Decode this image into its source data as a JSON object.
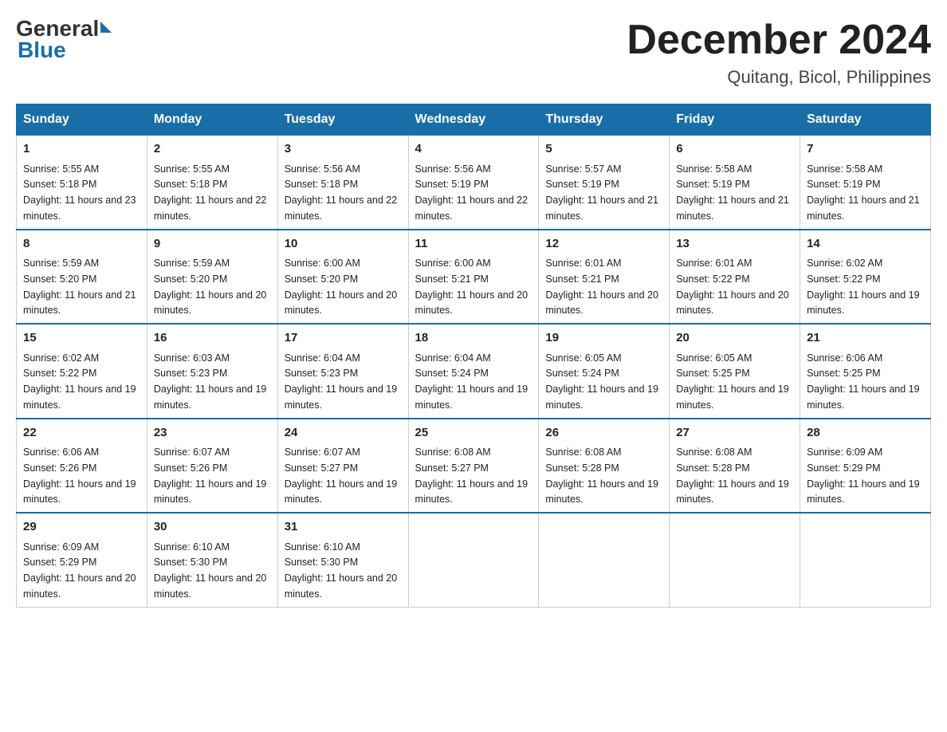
{
  "logo": {
    "general": "General",
    "blue": "Blue"
  },
  "header": {
    "month_year": "December 2024",
    "location": "Quitang, Bicol, Philippines"
  },
  "weekdays": [
    "Sunday",
    "Monday",
    "Tuesday",
    "Wednesday",
    "Thursday",
    "Friday",
    "Saturday"
  ],
  "weeks": [
    [
      {
        "day": "1",
        "sunrise": "5:55 AM",
        "sunset": "5:18 PM",
        "daylight": "11 hours and 23 minutes."
      },
      {
        "day": "2",
        "sunrise": "5:55 AM",
        "sunset": "5:18 PM",
        "daylight": "11 hours and 22 minutes."
      },
      {
        "day": "3",
        "sunrise": "5:56 AM",
        "sunset": "5:18 PM",
        "daylight": "11 hours and 22 minutes."
      },
      {
        "day": "4",
        "sunrise": "5:56 AM",
        "sunset": "5:19 PM",
        "daylight": "11 hours and 22 minutes."
      },
      {
        "day": "5",
        "sunrise": "5:57 AM",
        "sunset": "5:19 PM",
        "daylight": "11 hours and 21 minutes."
      },
      {
        "day": "6",
        "sunrise": "5:58 AM",
        "sunset": "5:19 PM",
        "daylight": "11 hours and 21 minutes."
      },
      {
        "day": "7",
        "sunrise": "5:58 AM",
        "sunset": "5:19 PM",
        "daylight": "11 hours and 21 minutes."
      }
    ],
    [
      {
        "day": "8",
        "sunrise": "5:59 AM",
        "sunset": "5:20 PM",
        "daylight": "11 hours and 21 minutes."
      },
      {
        "day": "9",
        "sunrise": "5:59 AM",
        "sunset": "5:20 PM",
        "daylight": "11 hours and 20 minutes."
      },
      {
        "day": "10",
        "sunrise": "6:00 AM",
        "sunset": "5:20 PM",
        "daylight": "11 hours and 20 minutes."
      },
      {
        "day": "11",
        "sunrise": "6:00 AM",
        "sunset": "5:21 PM",
        "daylight": "11 hours and 20 minutes."
      },
      {
        "day": "12",
        "sunrise": "6:01 AM",
        "sunset": "5:21 PM",
        "daylight": "11 hours and 20 minutes."
      },
      {
        "day": "13",
        "sunrise": "6:01 AM",
        "sunset": "5:22 PM",
        "daylight": "11 hours and 20 minutes."
      },
      {
        "day": "14",
        "sunrise": "6:02 AM",
        "sunset": "5:22 PM",
        "daylight": "11 hours and 19 minutes."
      }
    ],
    [
      {
        "day": "15",
        "sunrise": "6:02 AM",
        "sunset": "5:22 PM",
        "daylight": "11 hours and 19 minutes."
      },
      {
        "day": "16",
        "sunrise": "6:03 AM",
        "sunset": "5:23 PM",
        "daylight": "11 hours and 19 minutes."
      },
      {
        "day": "17",
        "sunrise": "6:04 AM",
        "sunset": "5:23 PM",
        "daylight": "11 hours and 19 minutes."
      },
      {
        "day": "18",
        "sunrise": "6:04 AM",
        "sunset": "5:24 PM",
        "daylight": "11 hours and 19 minutes."
      },
      {
        "day": "19",
        "sunrise": "6:05 AM",
        "sunset": "5:24 PM",
        "daylight": "11 hours and 19 minutes."
      },
      {
        "day": "20",
        "sunrise": "6:05 AM",
        "sunset": "5:25 PM",
        "daylight": "11 hours and 19 minutes."
      },
      {
        "day": "21",
        "sunrise": "6:06 AM",
        "sunset": "5:25 PM",
        "daylight": "11 hours and 19 minutes."
      }
    ],
    [
      {
        "day": "22",
        "sunrise": "6:06 AM",
        "sunset": "5:26 PM",
        "daylight": "11 hours and 19 minutes."
      },
      {
        "day": "23",
        "sunrise": "6:07 AM",
        "sunset": "5:26 PM",
        "daylight": "11 hours and 19 minutes."
      },
      {
        "day": "24",
        "sunrise": "6:07 AM",
        "sunset": "5:27 PM",
        "daylight": "11 hours and 19 minutes."
      },
      {
        "day": "25",
        "sunrise": "6:08 AM",
        "sunset": "5:27 PM",
        "daylight": "11 hours and 19 minutes."
      },
      {
        "day": "26",
        "sunrise": "6:08 AM",
        "sunset": "5:28 PM",
        "daylight": "11 hours and 19 minutes."
      },
      {
        "day": "27",
        "sunrise": "6:08 AM",
        "sunset": "5:28 PM",
        "daylight": "11 hours and 19 minutes."
      },
      {
        "day": "28",
        "sunrise": "6:09 AM",
        "sunset": "5:29 PM",
        "daylight": "11 hours and 19 minutes."
      }
    ],
    [
      {
        "day": "29",
        "sunrise": "6:09 AM",
        "sunset": "5:29 PM",
        "daylight": "11 hours and 20 minutes."
      },
      {
        "day": "30",
        "sunrise": "6:10 AM",
        "sunset": "5:30 PM",
        "daylight": "11 hours and 20 minutes."
      },
      {
        "day": "31",
        "sunrise": "6:10 AM",
        "sunset": "5:30 PM",
        "daylight": "11 hours and 20 minutes."
      },
      null,
      null,
      null,
      null
    ]
  ],
  "labels": {
    "sunrise": "Sunrise: ",
    "sunset": "Sunset: ",
    "daylight": "Daylight: "
  }
}
